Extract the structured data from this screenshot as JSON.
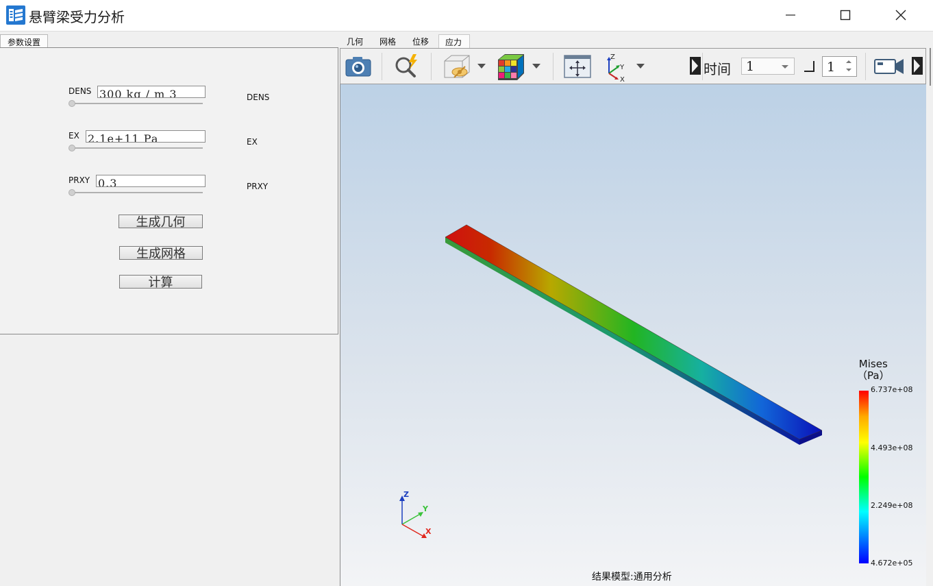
{
  "window": {
    "title": "悬臂梁受力分析"
  },
  "left_panel": {
    "tab_label": "参数设置",
    "params": [
      {
        "label": "DENS",
        "value": "300 kg / m  3",
        "right_label": "DENS"
      },
      {
        "label": "EX",
        "value": "2.1e+11 Pa",
        "right_label": "EX"
      },
      {
        "label": "PRXY",
        "value": "0.3",
        "right_label": "PRXY"
      }
    ],
    "buttons": {
      "generate_geometry": "生成几何",
      "generate_mesh": "生成网格",
      "compute": "计算"
    }
  },
  "right_panel": {
    "tabs": [
      "几何",
      "网格",
      "位移",
      "应力"
    ],
    "active_tab": "应力",
    "toolbar": {
      "time_label": "时间",
      "time_value": "1",
      "step_value": "1",
      "icons": [
        "camera-icon",
        "probe-icon",
        "visibility-icon",
        "color-cube-icon",
        "fit-view-icon",
        "axes-icon",
        "video-icon"
      ]
    },
    "viewport": {
      "legend_title_line1": "Mises",
      "legend_title_line2": "（Pa）",
      "legend_values": [
        "6.737e+08",
        "4.493e+08",
        "2.249e+08",
        "4.672e+05"
      ],
      "triad_labels": {
        "z": "Z",
        "y": "Y",
        "x": "X"
      },
      "footer": "结果模型:通用分析"
    }
  },
  "colors": {
    "accent": "#2478d0",
    "stress_max": "#ff0000",
    "stress_min": "#0000ff"
  }
}
